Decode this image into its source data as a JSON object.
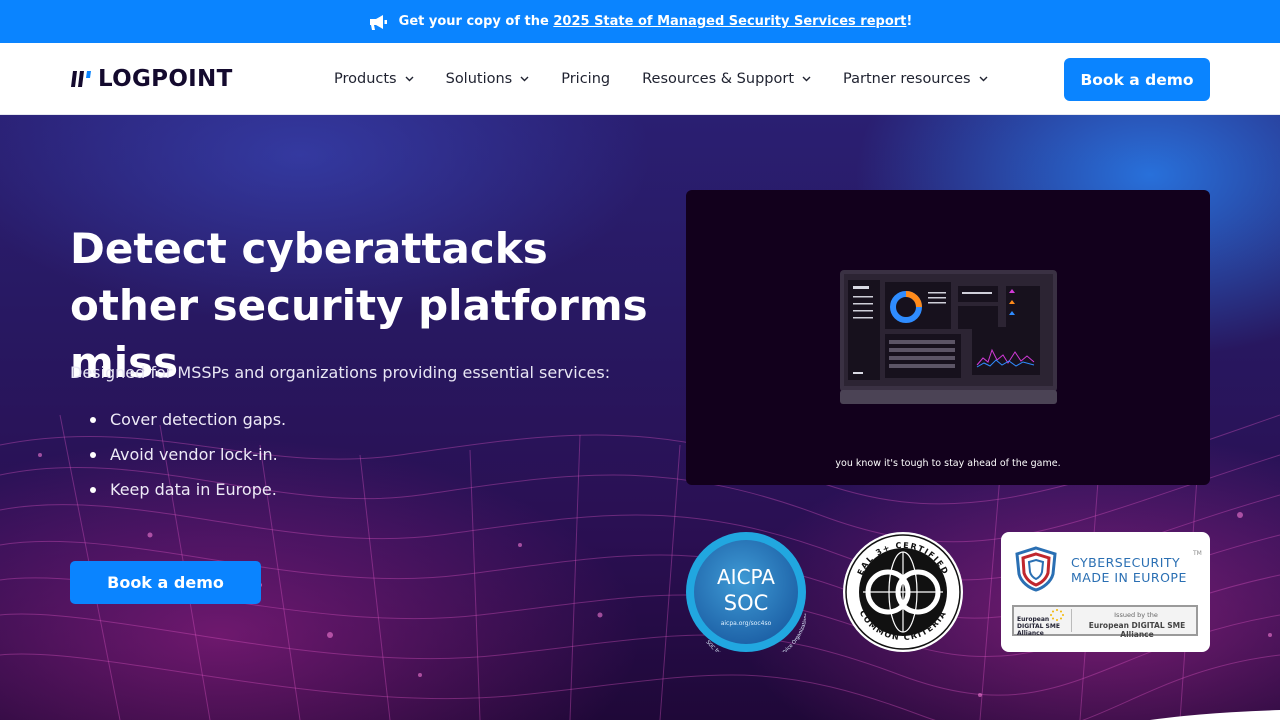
{
  "announcement": {
    "prefix": "Get your copy of the ",
    "link": "2025 State of Managed Security Services report",
    "suffix": "!"
  },
  "header": {
    "logo_text": "LOGPOINT",
    "nav": [
      {
        "label": "Products",
        "has_dropdown": true
      },
      {
        "label": "Solutions",
        "has_dropdown": true
      },
      {
        "label": "Pricing",
        "has_dropdown": false
      },
      {
        "label": "Resources & Support",
        "has_dropdown": true
      },
      {
        "label": "Partner resources",
        "has_dropdown": true
      }
    ],
    "cta": "Book a demo"
  },
  "hero": {
    "title": "Detect cyberattacks other security platforms miss",
    "subtitle": "Designed for MSSPs and organizations providing essential services:",
    "bullets": [
      "Cover detection gaps.",
      "Avoid vendor lock-in.",
      "Keep data in Europe."
    ],
    "cta": "Book a demo"
  },
  "video": {
    "caption": "you know it's tough to stay ahead of the game."
  },
  "badges": {
    "aicpa": {
      "title": "AICPA",
      "subtitle": "SOC",
      "url": "aicpa.org/soc4so",
      "ring": "SOC for Service Organizations | Service Organizations"
    },
    "cc": {
      "top": "EAL 3+ CERTIFIED",
      "bottom": "COMMON CRITERIA"
    },
    "eu": {
      "line1": "CYBERSECURITY",
      "line2": "MADE IN EUROPE",
      "tm": "TM",
      "box_label": "European DIGITAL SME Alliance",
      "issued": "Issued by the",
      "alliance": "European DIGITAL SME Alliance"
    }
  },
  "colors": {
    "brand_blue": "#0a84ff",
    "logo_dark": "#140a2e",
    "eu_blue": "#2a6fb3"
  }
}
